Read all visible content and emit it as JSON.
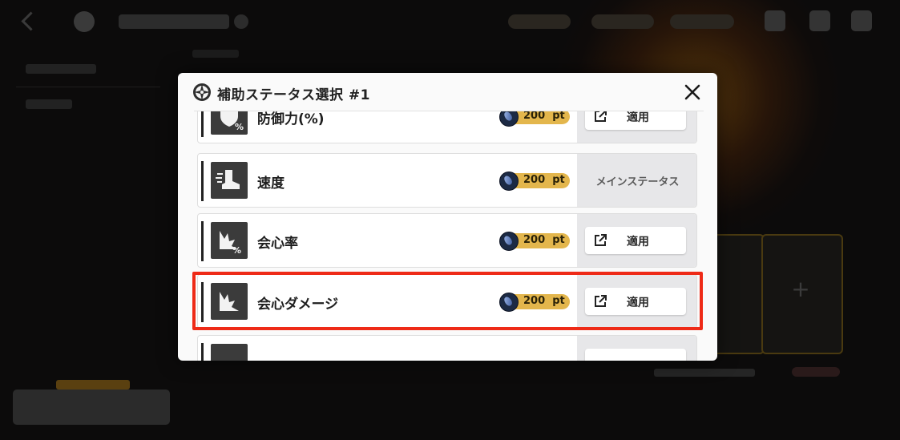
{
  "modal": {
    "title": "補助ステータス選択 #1",
    "rows": [
      {
        "name": "防御力(%)",
        "cost": "200  pt",
        "action": "適用",
        "state": "apply"
      },
      {
        "name": "速度",
        "cost": "200  pt",
        "action": "メインステータス",
        "state": "main"
      },
      {
        "name": "会心率",
        "cost": "200  pt",
        "action": "適用",
        "state": "apply"
      },
      {
        "name": "会心ダメージ",
        "cost": "200  pt",
        "action": "適用",
        "state": "apply",
        "highlighted": true
      },
      {
        "name": "",
        "cost": "",
        "action": "",
        "state": "apply"
      }
    ]
  },
  "colors": {
    "highlight": "#ee2a17",
    "cost_badge": "#e3b64c",
    "icon_bg": "#3b3b3b",
    "action_bg": "#e7e7e9"
  },
  "icons": {
    "row_icons": [
      "defense-percent-icon",
      "speed-boot-icon",
      "crit-rate-icon",
      "crit-damage-icon",
      "stat-icon"
    ]
  }
}
